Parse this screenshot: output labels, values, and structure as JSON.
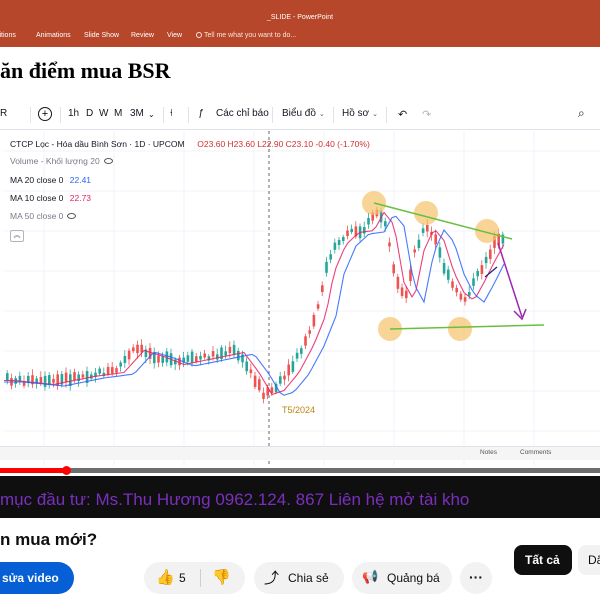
{
  "window": {
    "title": "_SLIDE - PowerPoint",
    "ribbon_tabs": [
      "sitions",
      "Animations",
      "Slide Show",
      "Review",
      "View"
    ],
    "tell_me": "Tell me what you want to do..."
  },
  "slide": {
    "title": "ăn điểm mua BSR"
  },
  "toolbar": {
    "symbol": "R",
    "intervals": [
      "1h",
      "D",
      "W",
      "M",
      "3M"
    ],
    "indicators_label": "Các chỉ báo",
    "chart_type_label": "Biểu đồ",
    "profile_label": "Hồ sơ"
  },
  "chart": {
    "symbol_title": "CTCP Lọc - Hóa dầu Bình Sơn · 1D · UPCOM",
    "ohlc": "O23.60  H23.60  L22.90  C23.10  -0.40 (-1.70%)",
    "volume_label": "Volume - Khối lượng 20",
    "ma20_label": "MA 20 close 0",
    "ma20_value": "22.41",
    "ma10_label": "MA 10 close 0",
    "ma10_value": "22.73",
    "ma50_label": "MA 50 close 0",
    "annotation": "T5/2024",
    "bottom_notes": "Notes",
    "bottom_comments": "Comments",
    "colors": {
      "up": "#26a69a",
      "down": "#ef5350",
      "ma20": "#2962ff",
      "ma10": "#e91e63",
      "highlight": "#f5c26b",
      "trendline": "#6abf40",
      "arrow": "#9c27b0"
    }
  },
  "video": {
    "progress": 0.11,
    "ticker": "mục đầu tư: Ms.Thu Hương 0962.124. 867  Liên hệ mở tài kho"
  },
  "youtube": {
    "title": "n mua mới?",
    "edit_button": "sửa video",
    "like_count": "5",
    "share_label": "Chia sẻ",
    "promote_label": "Quảng bá",
    "chip_all": "Tất cả",
    "chip_next": "Dã"
  }
}
